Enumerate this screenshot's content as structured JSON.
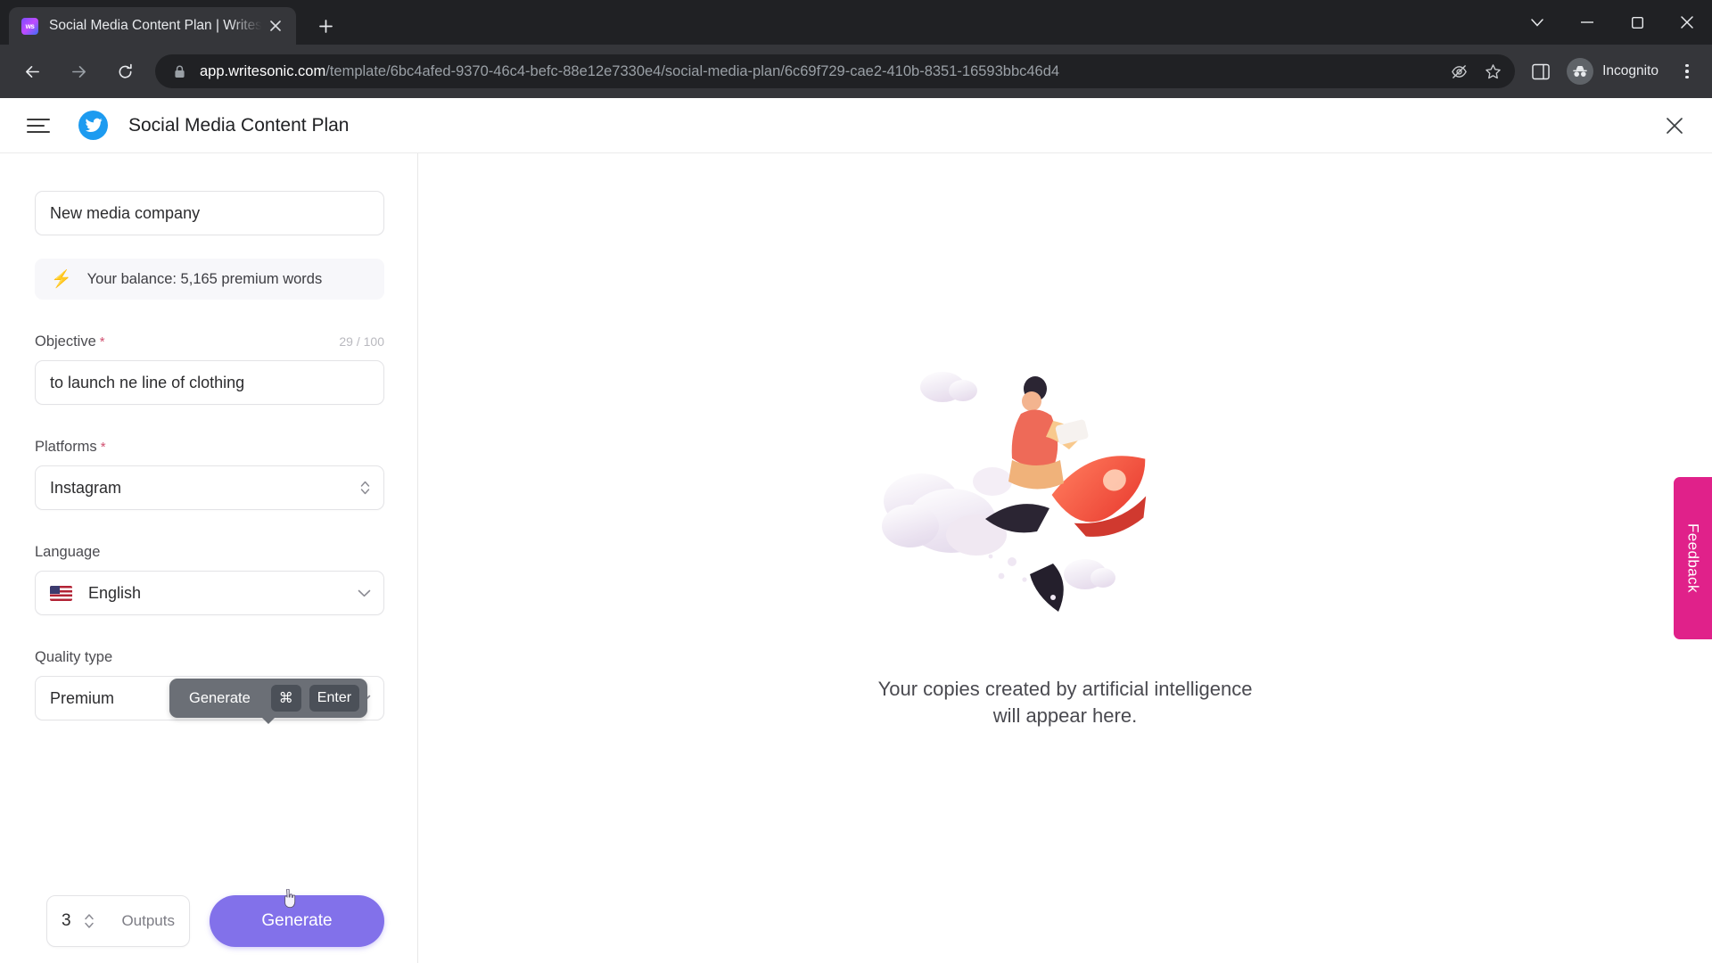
{
  "browser": {
    "tab": {
      "title": "Social Media Content Plan | Writes",
      "favicon_label": "ws",
      "close_icon": "close-icon"
    },
    "new_tab_icon": "plus-icon",
    "window_controls": {
      "more_icon": "chevron-down-icon",
      "minimize_icon": "minimize-icon",
      "maximize_icon": "maximize-icon",
      "close_icon": "close-icon"
    },
    "nav": {
      "back_icon": "back-arrow-icon",
      "forward_icon": "forward-arrow-icon",
      "reload_icon": "reload-icon"
    },
    "omnibox": {
      "lock_icon": "lock-icon",
      "host": "app.writesonic.com",
      "path": "/template/6bc4afed-9370-46c4-befc-88e12e7330e4/social-media-plan/6c69f729-cae2-410b-8351-16593bbc46d4",
      "tracking_icon": "eye-slash-icon",
      "bookmark_icon": "star-icon"
    },
    "side_panel_icon": "side-panel-icon",
    "incognito": {
      "label": "Incognito",
      "avatar_icon": "incognito-avatar-icon"
    },
    "menu_icon": "kebab-menu-icon"
  },
  "app": {
    "header": {
      "menu_icon": "hamburger-menu-icon",
      "logo_icon": "twitter-bird-icon",
      "title": "Social Media Content Plan",
      "close_icon": "close-icon"
    },
    "form": {
      "project_name": {
        "value": "New media company"
      },
      "balance": {
        "icon": "lightning-bolt-icon",
        "text": "Your balance: 5,165 premium words",
        "accent_color": "#6a52e8"
      },
      "objective": {
        "label": "Objective",
        "required_marker": "*",
        "counter": "29 / 100",
        "value": "to launch ne line of clothing"
      },
      "platforms": {
        "label": "Platforms",
        "required_marker": "*",
        "value": "Instagram",
        "icon": "up-down-chevron-icon"
      },
      "language": {
        "label": "Language",
        "value": "English",
        "flag": "us-flag-icon",
        "icon": "chevron-down-icon"
      },
      "quality_type": {
        "label": "Quality type",
        "value": "Premium",
        "icon": "chevron-down-icon"
      }
    },
    "tooltip": {
      "label": "Generate",
      "key_command": "⌘",
      "key_enter": "Enter"
    },
    "footer": {
      "outputs_count": "3",
      "outputs_label": "Outputs",
      "stepper_icon": "stepper-arrows-icon",
      "generate_label": "Generate",
      "generate_color": "#8271ea"
    },
    "preview": {
      "illustration": "rocket-launch-illustration",
      "line1": "Your copies created by artificial intelligence",
      "line2": "will appear here."
    },
    "feedback": {
      "label": "Feedback",
      "color": "#e0218a"
    }
  }
}
